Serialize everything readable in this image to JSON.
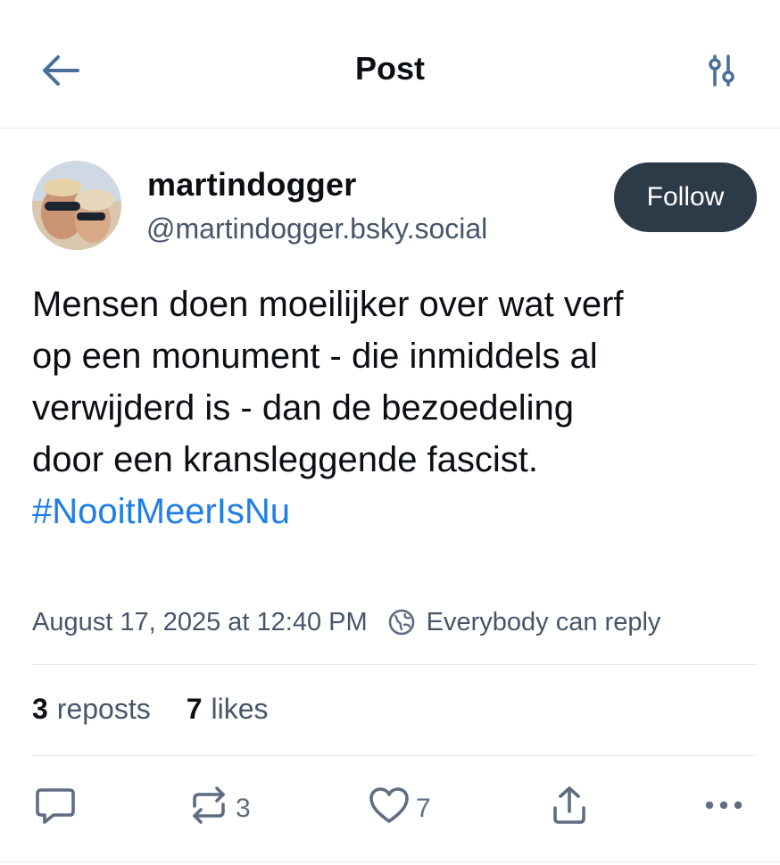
{
  "header": {
    "title": "Post"
  },
  "author": {
    "display_name": "martindogger",
    "handle": "@martindogger.bsky.social",
    "follow_label": "Follow"
  },
  "post": {
    "text_lines": [
      "Mensen doen moeilijker over wat verf",
      "op een monument - die inmiddels al",
      "verwijderd is - dan de bezoedeling",
      "door een kransleggende fascist."
    ],
    "hashtag": "#NooitMeerIsNu",
    "timestamp": "August 17, 2025 at 12:40 PM",
    "reply_setting": "Everybody can reply"
  },
  "stats": {
    "reposts_count": "3",
    "reposts_label": "reposts",
    "likes_count": "7",
    "likes_label": "likes"
  },
  "actions": {
    "repost_count": "3",
    "like_count": "7"
  },
  "icons": {
    "back": "arrow-left-icon",
    "settings": "sliders-icon",
    "reply_setting": "globe-icon",
    "reply": "comment-icon",
    "repost": "repost-icon",
    "like": "heart-icon",
    "share": "share-icon",
    "more": "ellipsis-icon"
  },
  "colors": {
    "follow_bg": "#2d3a48",
    "hashtag": "#1f7ee8",
    "muted_text": "#46566a",
    "action_icon": "#5e6d81"
  }
}
